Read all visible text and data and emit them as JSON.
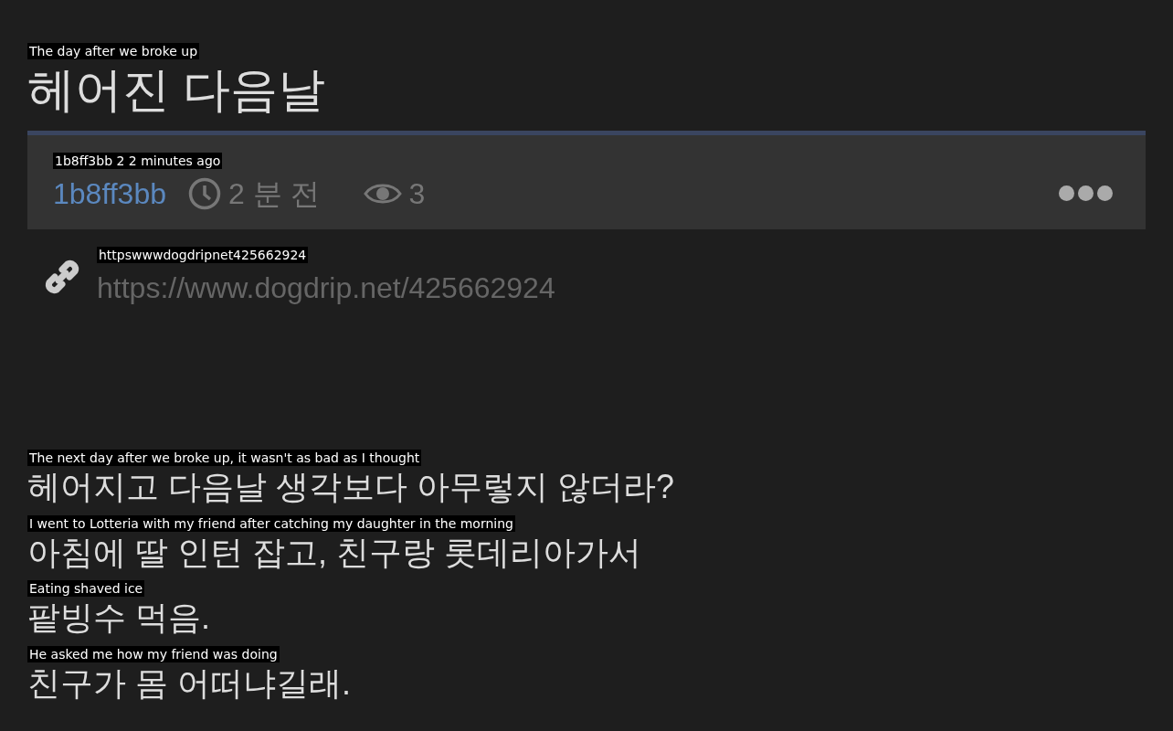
{
  "post": {
    "title": "헤어진 다음날",
    "title_translation": "The day after we broke up"
  },
  "meta": {
    "translation": "1b8ff3bb 2 2 minutes ago",
    "author": "1b8ff3bb",
    "time": "2 분 전",
    "views": "3"
  },
  "link": {
    "translation": "httpswwwdogdripnet425662924",
    "url": "https://www.dogdrip.net/425662924"
  },
  "body": [
    {
      "translation": "The next day after we broke up, it wasn't as bad as I thought",
      "text": "헤어지고 다음날 생각보다 아무렇지 않더라?"
    },
    {
      "translation": "I went to Lotteria with my friend after catching my daughter in the morning",
      "text": "아침에 딸 인턴 잡고, 친구랑 롯데리아가서"
    },
    {
      "translation": "Eating shaved ice",
      "text": "팥빙수 먹음."
    },
    {
      "translation": "He asked me how my friend was doing",
      "text": "친구가 몸 어떠냐길래."
    }
  ]
}
